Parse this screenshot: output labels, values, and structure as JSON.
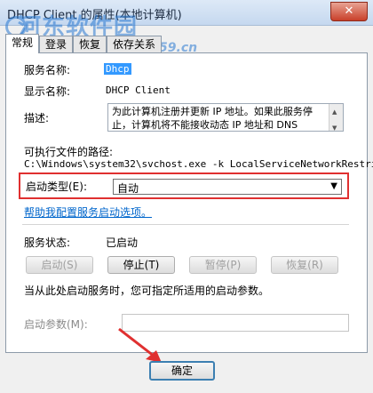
{
  "window": {
    "title": "DHCP Client 的属性(本地计算机)",
    "close_glyph": "✕"
  },
  "watermark": {
    "text": "河东软件园",
    "url": "www.pc0359.cn"
  },
  "tabs": [
    {
      "label": "常规"
    },
    {
      "label": "登录"
    },
    {
      "label": "恢复"
    },
    {
      "label": "依存关系"
    }
  ],
  "general": {
    "service_name_label": "服务名称:",
    "service_name_value": "Dhcp",
    "display_name_label": "显示名称:",
    "display_name_value": "DHCP Client",
    "description_label": "描述:",
    "description_value": "为此计算机注册并更新 IP 地址。如果此服务停止，计算机将不能接收动态 IP 地址和 DNS",
    "exe_path_label": "可执行文件的路径:",
    "exe_path_value": "C:\\Windows\\system32\\svchost.exe -k LocalServiceNetworkRestri",
    "startup_type_label": "启动类型(E):",
    "startup_type_value": "自动",
    "help_link": "帮助我配置服务启动选项。",
    "service_status_label": "服务状态:",
    "service_status_value": "已启动",
    "buttons": {
      "start": "启动(S)",
      "stop": "停止(T)",
      "pause": "暂停(P)",
      "resume": "恢复(R)"
    },
    "hint_text": "当从此处启动服务时，您可指定所适用的启动参数。",
    "start_params_label": "启动参数(M):",
    "start_params_value": ""
  },
  "footer": {
    "ok_label": "确定"
  },
  "colors": {
    "highlight": "#e03030",
    "link": "#0066cc",
    "selection": "#3399ff"
  }
}
